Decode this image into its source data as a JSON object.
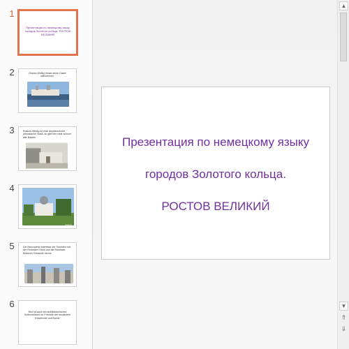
{
  "slides": [
    {
      "number": "1",
      "text": "Презентация по немецкому языку городов Золотого кольца. РОСТОВ ВЕЛИКИЙ"
    },
    {
      "number": "2",
      "text": "Rostov Weliký heisst seine Gaste willkommen.",
      "credit": "uroki.ru"
    },
    {
      "number": "3",
      "text": "Rostow Weliky ist eine wunderschone altrussische Stadt, du gibt hier viele schone alte Bauten.",
      "credit": ""
    },
    {
      "number": "4",
      "text": "",
      "credit": "uroki.ru"
    },
    {
      "number": "5",
      "text": "Die Besonderst Interesse der Touristen ruft der Rostower Kreml und die Rostower Museum Gebaude hervor.",
      "credit": ""
    },
    {
      "number": "6",
      "text": "Hier ist auch ein architektonisches Kulturzentrum fur Freunde der russischen Geschichte und Kunst."
    }
  ],
  "current_slide": {
    "title_line1": "Презентация по немецкому языку",
    "title_line2": "городов Золотого кольца.",
    "title_line3": "РОСТОВ ВЕЛИКИЙ"
  },
  "scrollbar": {
    "up_icon": "triangle-up",
    "down_icon": "triangle-down",
    "prev_slide_icon": "double-chevron-up",
    "next_slide_icon": "double-chevron-down"
  },
  "colors": {
    "accent": "#e0744f",
    "title": "#7030a0"
  }
}
